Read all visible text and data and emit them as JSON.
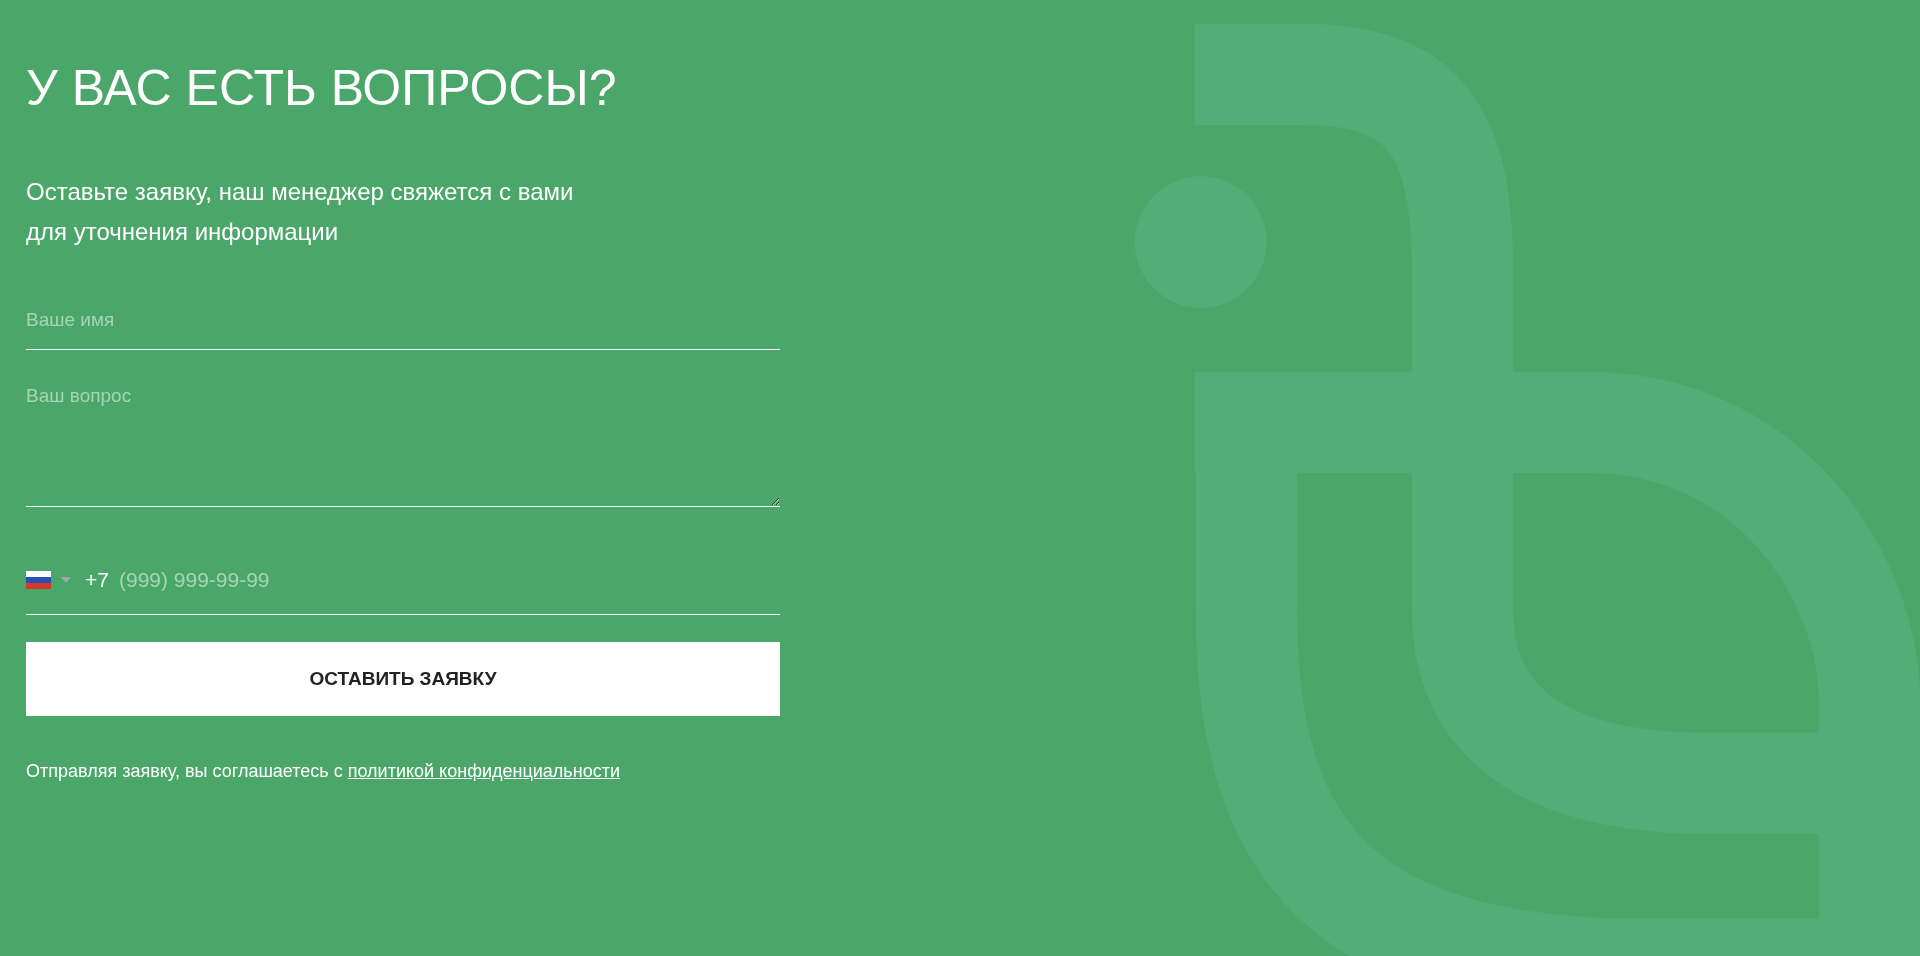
{
  "heading": "У ВАС ЕСТЬ ВОПРОСЫ?",
  "subtitle_lines": [
    "Оставьте заявку, наш менеджер свяжется с вами",
    "для уточнения информации"
  ],
  "form": {
    "name_field": {
      "placeholder": "Ваше имя"
    },
    "question_field": {
      "placeholder": "Ваш вопрос"
    },
    "phone_field": {
      "country_code": "+7",
      "placeholder": "(999) 999-99-99"
    },
    "submit_button": "ОСТАВИТЬ ЗАЯВКУ",
    "consent": {
      "text": "Отправляя заявку, вы соглашаетесь с",
      "link": "политикой конфиденциальности"
    }
  }
}
